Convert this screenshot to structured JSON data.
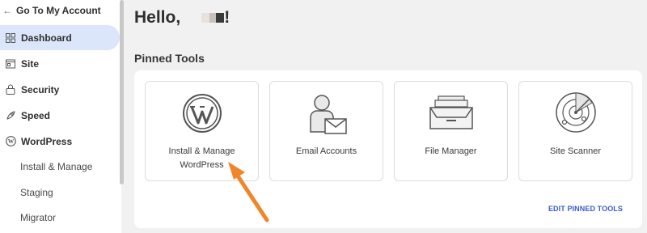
{
  "sidebar": {
    "back_label": "Go To My Account",
    "items": [
      {
        "label": "Dashboard",
        "icon": "dashboard-icon",
        "active": true
      },
      {
        "label": "Site",
        "icon": "site-icon"
      },
      {
        "label": "Security",
        "icon": "lock-icon"
      },
      {
        "label": "Speed",
        "icon": "rocket-icon"
      },
      {
        "label": "WordPress",
        "icon": "wordpress-icon"
      }
    ],
    "sub_items": [
      "Install & Manage",
      "Staging",
      "Migrator"
    ]
  },
  "main": {
    "greeting": "Hello,",
    "greeting_suffix": "!",
    "pinned_title": "Pinned Tools",
    "tools": [
      {
        "label_line1": "Install & Manage",
        "label_line2": "WordPress",
        "icon": "wordpress-logo-icon"
      },
      {
        "label_line1": "Email Accounts",
        "label_line2": "",
        "icon": "email-accounts-icon"
      },
      {
        "label_line1": "File Manager",
        "label_line2": "",
        "icon": "file-manager-icon"
      },
      {
        "label_line1": "Site Scanner",
        "label_line2": "",
        "icon": "site-scanner-icon"
      }
    ],
    "edit_label": "EDIT PINNED TOOLS"
  },
  "colors": {
    "accent": "#3b5bcf",
    "active_bg": "#dce6fa",
    "arrow": "#f0852a",
    "background": "#f1f1f1"
  }
}
